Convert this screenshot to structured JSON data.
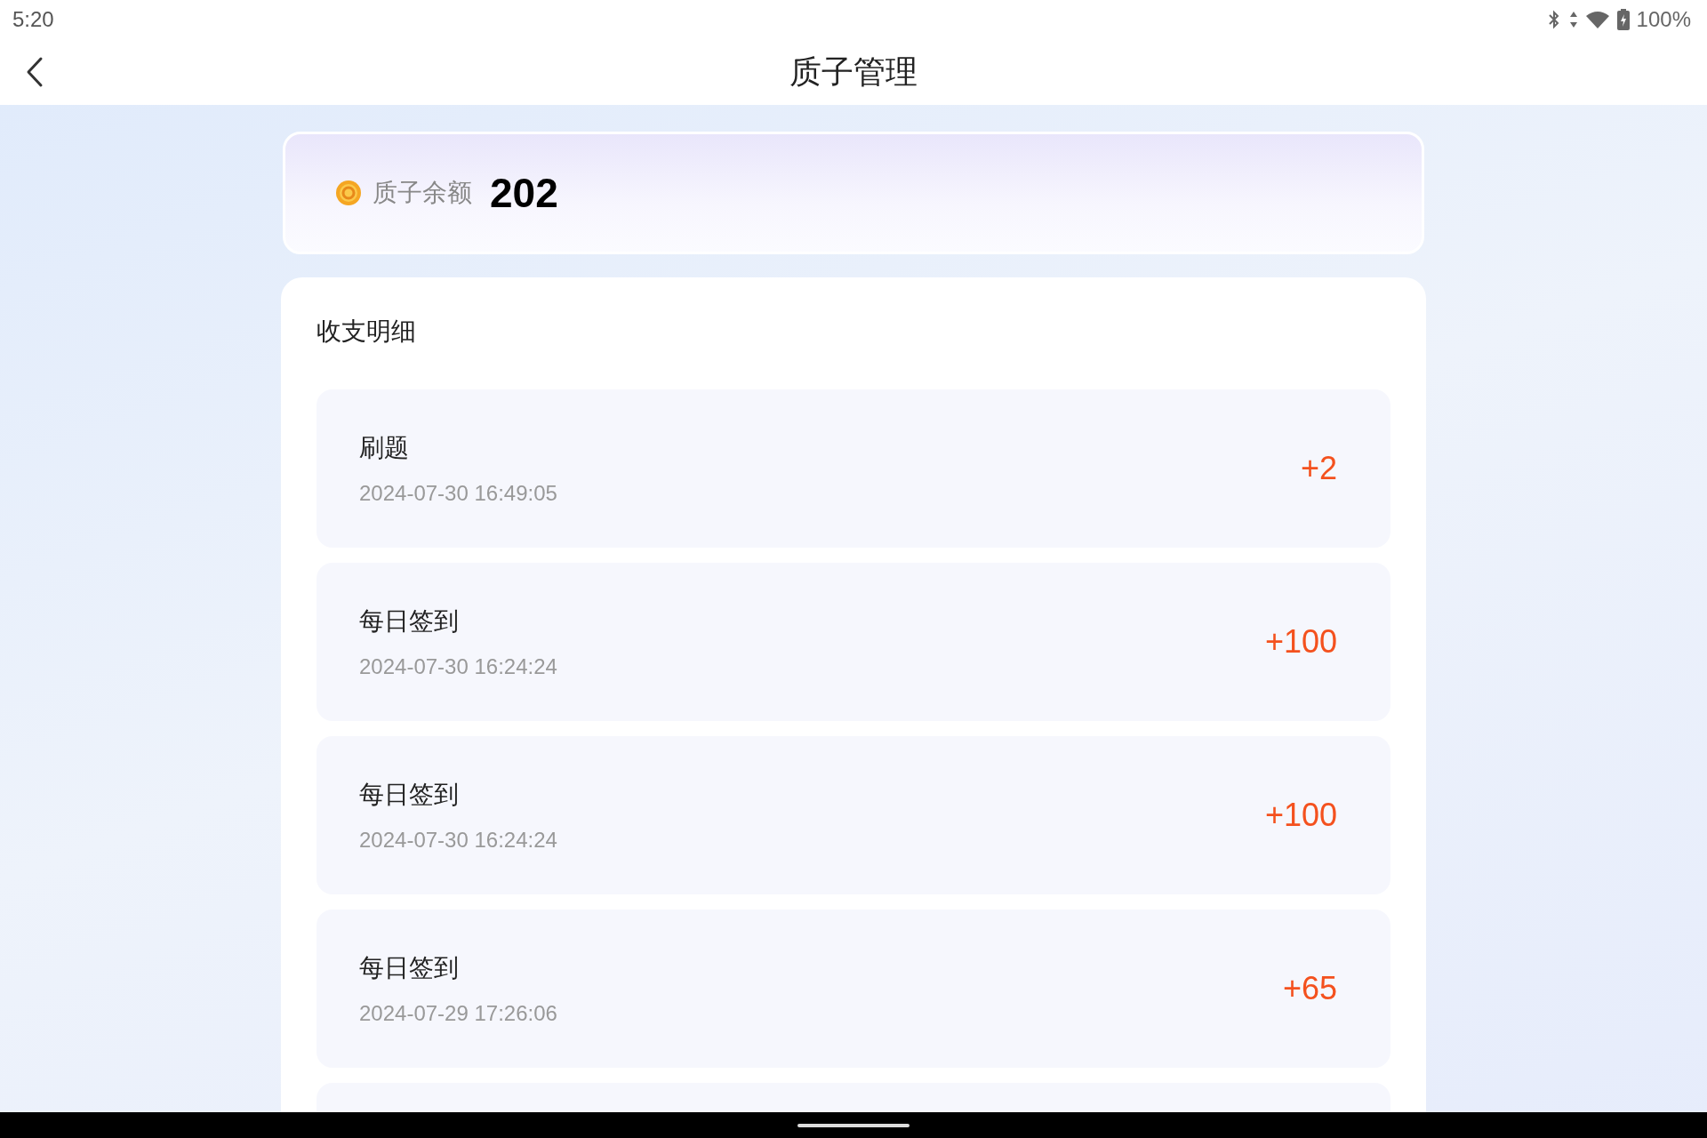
{
  "status_bar": {
    "time": "5:20",
    "battery": "100%"
  },
  "header": {
    "title": "质子管理"
  },
  "balance": {
    "label": "质子余额",
    "value": "202"
  },
  "details": {
    "title": "收支明细",
    "items": [
      {
        "name": "刷题",
        "time": "2024-07-30 16:49:05",
        "amount": "+2"
      },
      {
        "name": "每日签到",
        "time": "2024-07-30 16:24:24",
        "amount": "+100"
      },
      {
        "name": "每日签到",
        "time": "2024-07-30 16:24:24",
        "amount": "+100"
      },
      {
        "name": "每日签到",
        "time": "2024-07-29 17:26:06",
        "amount": "+65"
      }
    ]
  }
}
